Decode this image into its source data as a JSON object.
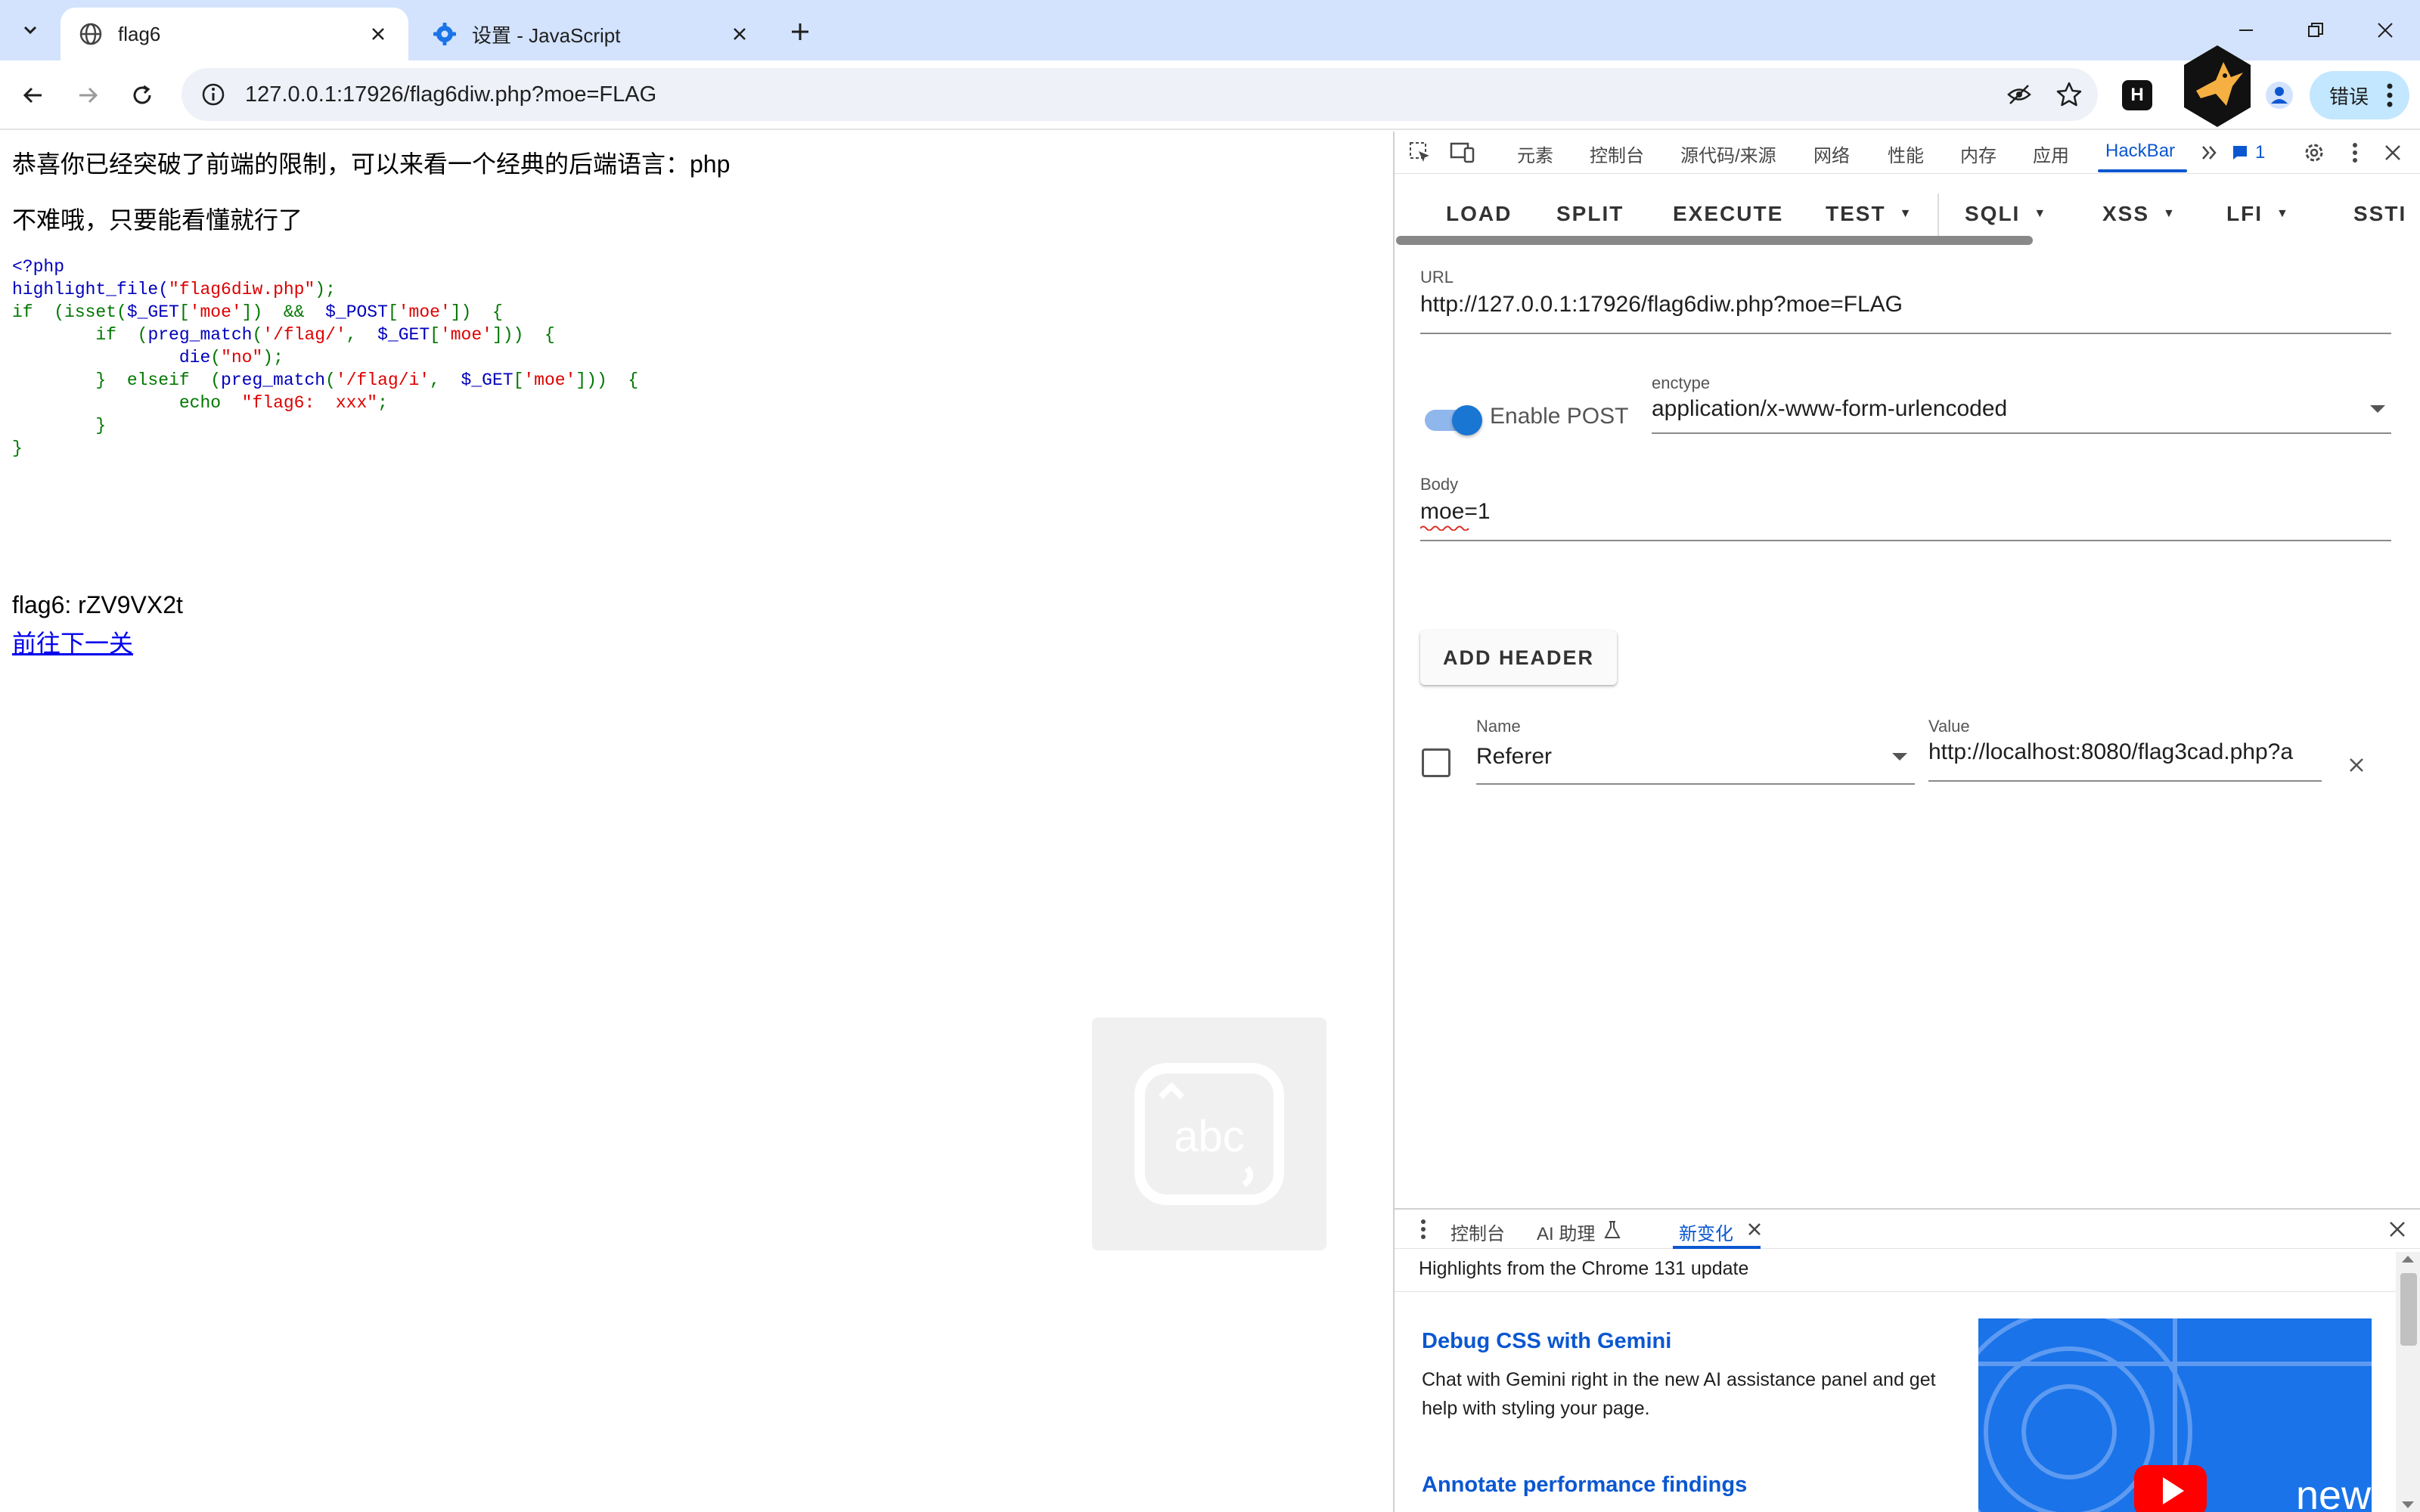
{
  "browser": {
    "tabs": [
      {
        "title": "flag6",
        "icon": "globe-icon",
        "active": true
      },
      {
        "title": "设置 - JavaScript",
        "icon": "settings-gear-icon",
        "active": false
      }
    ],
    "address": "127.0.0.1:17926/flag6diw.php?moe=FLAG",
    "error_chip": "错误",
    "extension_h": "H"
  },
  "page": {
    "line1": "恭喜你已经突破了前端的限制，可以来看一个经典的后端语言：php",
    "line2": "不难哦，只要能看懂就行了",
    "code": {
      "l1": "<?php",
      "l2a": "highlight_file(",
      "l2b": "\"flag6diw.php\"",
      "l2c": ");",
      "l3a": "if  (isset(",
      "l3b": "$_GET",
      "l3c": "[",
      "l3d": "'moe'",
      "l3e": "])  &&  ",
      "l3f": "$_POST",
      "l3g": "[",
      "l3h": "'moe'",
      "l3i": "])  {",
      "l4a": "        if  (",
      "l4b": "preg_match",
      "l4c": "(",
      "l4d": "'/flag/'",
      "l4e": ",  ",
      "l4f": "$_GET",
      "l4g": "[",
      "l4h": "'moe'",
      "l4i": "]))  {",
      "l5a": "                ",
      "l5b": "die",
      "l5c": "(",
      "l5d": "\"no\"",
      "l5e": ");",
      "l6a": "        }  elseif  (",
      "l6b": "preg_match",
      "l6c": "(",
      "l6d": "'/flag/i'",
      "l6e": ",  ",
      "l6f": "$_GET",
      "l6g": "[",
      "l6h": "'moe'",
      "l6i": "]))  {",
      "l7a": "                echo  ",
      "l7b": "\"flag6:  xxx\"",
      "l7c": ";",
      "l8": "        }",
      "l9": "}"
    },
    "flag_output": "flag6: rZV9VX2t",
    "next_link": "前往下一关",
    "overlay_text": "abc"
  },
  "devtools": {
    "tabs": [
      "元素",
      "控制台",
      "源代码/来源",
      "网络",
      "性能",
      "内存",
      "应用",
      "HackBar"
    ],
    "active_tab": "HackBar",
    "message_count": "1",
    "hackbar": {
      "buttons": [
        "LOAD",
        "SPLIT",
        "EXECUTE",
        "TEST",
        "SQLI",
        "XSS",
        "LFI",
        "SSTI"
      ],
      "url_label": "URL",
      "url_value": "http://127.0.0.1:17926/flag6diw.php?moe=FLAG",
      "enable_post_label": "Enable POST",
      "enable_post": true,
      "enctype_label": "enctype",
      "enctype_value": "application/x-www-form-urlencoded",
      "body_label": "Body",
      "body_value": "moe=1",
      "add_header_label": "ADD HEADER",
      "header_name_label": "Name",
      "header_name_value": "Referer",
      "header_value_label": "Value",
      "header_value_value": "http://localhost:8080/flag3cad.php?a"
    },
    "drawer": {
      "tabs": [
        "控制台",
        "AI 助理",
        "新变化"
      ],
      "active_tab": "新变化",
      "header": "Highlights from the Chrome 131 update",
      "h1": "Debug CSS with Gemini",
      "p1": "Chat with Gemini right in the new AI assistance panel and get help with styling your page.",
      "h2": "Annotate performance findings",
      "thumb_label": "new"
    }
  }
}
